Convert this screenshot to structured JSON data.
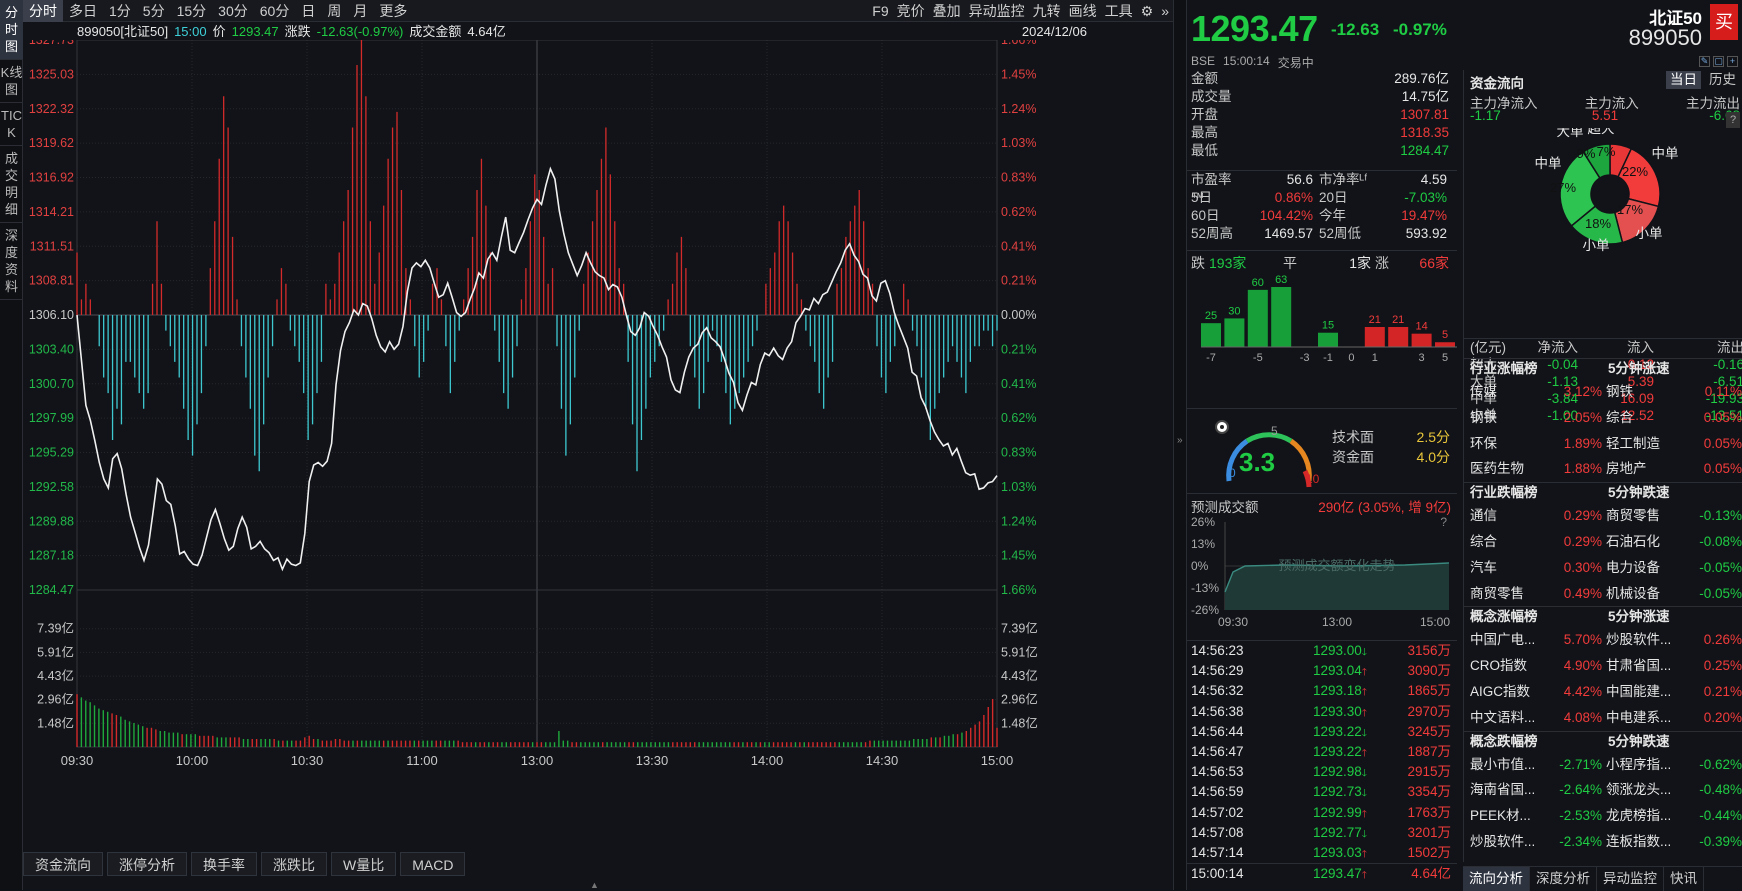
{
  "left_tabs": [
    {
      "label": "分时图",
      "active": true
    },
    {
      "label": "K线图"
    },
    {
      "label": "TICK"
    },
    {
      "label": "成交明细"
    },
    {
      "label": "深度资料"
    }
  ],
  "top_tabs": [
    {
      "label": "分时",
      "active": true
    },
    {
      "label": "多日"
    },
    {
      "label": "1分"
    },
    {
      "label": "5分"
    },
    {
      "label": "15分"
    },
    {
      "label": "30分"
    },
    {
      "label": "60分"
    },
    {
      "label": "日"
    },
    {
      "label": "周"
    },
    {
      "label": "月"
    },
    {
      "label": "更多"
    }
  ],
  "right_tools": [
    "F9",
    "竞价",
    "叠加",
    "异动监控",
    "九转",
    "画线",
    "工具"
  ],
  "info": {
    "code": "899050[北证50]",
    "time": "15:00",
    "price_label": "价",
    "price": "1293.47",
    "chg_label": "涨跌",
    "chg": "-12.63(-0.97%)",
    "amount_label": "成交金额",
    "amount": "4.64亿",
    "date": "2024/12/06"
  },
  "chart_data": {
    "type": "line",
    "x_ticks": [
      "09:30",
      "10:00",
      "10:30",
      "11:00",
      "13:00",
      "13:30",
      "14:00",
      "14:30",
      "15:00"
    ],
    "y_left_ticks": [
      "1327.73",
      "1325.03",
      "1322.32",
      "1319.62",
      "1316.92",
      "1314.21",
      "1311.51",
      "1308.81",
      "1306.10",
      "1303.40",
      "1300.70",
      "1297.99",
      "1295.29",
      "1292.58",
      "1289.88",
      "1287.18",
      "1284.47"
    ],
    "y_right_ticks": [
      "1.66%",
      "1.45%",
      "1.24%",
      "1.03%",
      "0.83%",
      "0.62%",
      "0.41%",
      "0.21%",
      "0.00%",
      "0.21%",
      "0.41%",
      "0.62%",
      "0.83%",
      "1.03%",
      "1.24%",
      "1.45%",
      "1.66%"
    ],
    "ylim": [
      1284.47,
      1327.73
    ],
    "prev_close": 1306.1,
    "price": [
      1306.1,
      1302.5,
      1299.0,
      1297.8,
      1296.2,
      1294.5,
      1293.2,
      1292.5,
      1294.8,
      1295.2,
      1294.0,
      1292.0,
      1290.2,
      1289.0,
      1287.8,
      1286.8,
      1288.0,
      1290.5,
      1293.2,
      1292.8,
      1291.5,
      1291.2,
      1289.5,
      1287.3,
      1287.5,
      1286.9,
      1286.5,
      1286.4,
      1287.2,
      1288.6,
      1290.0,
      1290.8,
      1289.7,
      1288.5,
      1287.6,
      1287.9,
      1289.3,
      1290.2,
      1289.4,
      1287.7,
      1287.9,
      1288.3,
      1287.7,
      1287.4,
      1286.8,
      1287.0,
      1286.1,
      1286.9,
      1286.5,
      1286.4,
      1286.6,
      1288.9,
      1293.0,
      1294.3,
      1294.5,
      1294.2,
      1294.6,
      1296.0,
      1300.6,
      1303.3,
      1304.8,
      1305.5,
      1306.5,
      1306.1,
      1307.0,
      1306.8,
      1305.8,
      1304.5,
      1303.6,
      1303.2,
      1304.0,
      1303.4,
      1303.8,
      1305.2,
      1308.0,
      1309.8,
      1310.2,
      1309.9,
      1310.4,
      1309.8,
      1308.6,
      1307.5,
      1307.7,
      1308.6,
      1307.5,
      1306.3,
      1306.0,
      1306.3,
      1307.3,
      1308.2,
      1309.4,
      1309.0,
      1310.5,
      1311.0,
      1310.4,
      1312.2,
      1313.8,
      1311.2,
      1311.0,
      1311.8,
      1312.6,
      1313.6,
      1314.5,
      1315.2,
      1314.8,
      1316.3,
      1317.6,
      1316.8,
      1314.3,
      1312.5,
      1311.0,
      1310.1,
      1309.2,
      1310.0,
      1311.0,
      1310.2,
      1309.5,
      1309.2,
      1309.0,
      1308.1,
      1308.5,
      1308.3,
      1307.5,
      1306.1,
      1304.8,
      1304.5,
      1305.1,
      1306.3,
      1306.0,
      1305.2,
      1304.5,
      1303.6,
      1302.8,
      1301.0,
      1300.2,
      1300.0,
      1301.6,
      1302.8,
      1303.5,
      1303.8,
      1304.7,
      1305.1,
      1304.3,
      1304.0,
      1303.6,
      1302.6,
      1301.5,
      1300.8,
      1299.2,
      1298.6,
      1299.8,
      1300.8,
      1300.6,
      1302.2,
      1303.1,
      1302.9,
      1303.5,
      1302.9,
      1302.6,
      1303.5,
      1304.0,
      1305.5,
      1306.0,
      1306.6,
      1306.5,
      1307.4,
      1307.0,
      1307.7,
      1307.9,
      1308.7,
      1309.5,
      1310.2,
      1311.2,
      1311.7,
      1310.8,
      1310.3,
      1309.3,
      1309.0,
      1307.6,
      1307.2,
      1308.6,
      1308.8,
      1307.8,
      1306.3,
      1305.3,
      1304.4,
      1303.5,
      1301.6,
      1301.3,
      1299.6,
      1298.9,
      1297.8,
      1296.9,
      1296.3,
      1295.8,
      1296.0,
      1295.1,
      1295.6,
      1294.6,
      1293.7,
      1293.5,
      1293.6,
      1292.4,
      1292.5,
      1292.9,
      1293.0,
      1293.47
    ],
    "minute_bars": [
      4,
      1,
      2,
      1,
      0,
      -2,
      -4,
      -5,
      -8,
      -6,
      -7,
      -3,
      -3,
      -4,
      -5,
      -6,
      -5,
      2,
      6,
      2,
      -1,
      -2,
      -3,
      -4,
      -6,
      -8,
      -9,
      -7,
      -5,
      -2,
      3,
      6,
      10,
      14,
      12,
      5,
      1,
      -2,
      -4,
      -6,
      -9,
      -10,
      -7,
      -4,
      -2,
      1,
      3,
      2,
      -1,
      -2,
      -3,
      -5,
      -8,
      -7,
      -5,
      -3,
      2,
      1,
      2,
      4,
      6,
      8,
      12,
      16,
      18,
      14,
      6,
      2,
      4,
      7,
      10,
      12,
      13,
      8,
      3,
      1,
      -2,
      -4,
      -3,
      -1,
      2,
      3,
      1,
      -2,
      -5,
      -3,
      -1,
      1,
      3,
      5,
      8,
      10,
      7,
      4,
      -1,
      -3,
      -5,
      -6,
      -4,
      -2,
      1,
      3,
      6,
      9,
      8,
      5,
      2,
      3,
      -2,
      -6,
      -9,
      -7,
      -4,
      -1,
      2,
      4,
      6,
      8,
      10,
      12,
      9,
      6,
      3,
      2,
      -3,
      -7,
      -10,
      -8,
      -6,
      -4,
      -3,
      -2,
      -1,
      1,
      2,
      4,
      5,
      3,
      -2,
      -4,
      -6,
      -5,
      -3,
      -1,
      -2,
      -3,
      -5,
      -7,
      -6,
      -5,
      -4,
      -3,
      -2,
      -1,
      0,
      2,
      3,
      4,
      6,
      7,
      6,
      4,
      2,
      1,
      -1,
      -2,
      -3,
      -5,
      -6,
      -4,
      -3,
      2,
      3,
      5,
      6,
      7,
      8,
      6,
      3,
      2,
      -2,
      -4,
      -5,
      -3,
      -2,
      0,
      2,
      1,
      -1,
      -2,
      -4,
      -6,
      -8,
      -6,
      -5,
      -4,
      -3,
      -2,
      -3,
      -4,
      -5,
      -3,
      -2,
      -2,
      -1,
      -1,
      -2,
      -1
    ]
  },
  "volume": {
    "y_ticks": [
      "7.39亿",
      "5.91亿",
      "4.43亿",
      "2.96亿",
      "1.48亿"
    ],
    "ylim": [
      0,
      8.87
    ],
    "values": [
      3.3,
      3.1,
      2.9,
      2.8,
      2.6,
      2.4,
      2.3,
      2.2,
      2.1,
      2.0,
      1.9,
      1.7,
      1.6,
      1.5,
      1.4,
      1.3,
      1.2,
      1.2,
      1.1,
      1.0,
      1.0,
      0.9,
      0.9,
      0.9,
      0.8,
      0.8,
      0.8,
      0.8,
      0.7,
      0.7,
      0.7,
      0.7,
      0.6,
      0.6,
      0.6,
      0.6,
      0.6,
      0.6,
      0.5,
      0.5,
      0.5,
      0.5,
      0.5,
      0.5,
      0.5,
      0.5,
      0.4,
      0.4,
      0.4,
      0.4,
      0.4,
      0.4,
      0.6,
      0.7,
      0.5,
      0.5,
      0.4,
      0.4,
      0.4,
      0.5,
      0.5,
      0.4,
      0.4,
      0.4,
      0.4,
      0.4,
      0.4,
      0.4,
      0.4,
      0.4,
      0.4,
      0.4,
      0.4,
      0.4,
      0.4,
      0.4,
      0.4,
      0.4,
      0.4,
      0.4,
      0.4,
      0.4,
      0.4,
      0.4,
      0.4,
      0.4,
      0.4,
      0.4,
      0.3,
      0.3,
      0.3,
      0.3,
      0.3,
      0.3,
      0.3,
      0.3,
      0.3,
      0.3,
      0.3,
      0.3,
      0.3,
      0.3,
      0.3,
      0.3,
      0.3,
      0.3,
      0.3,
      0.3,
      0.3,
      0.3,
      1.0,
      0.4,
      0.4,
      0.3,
      0.3,
      0.3,
      0.3,
      0.3,
      0.3,
      0.3,
      0.3,
      0.3,
      0.3,
      0.3,
      0.3,
      0.3,
      0.3,
      0.3,
      0.3,
      0.3,
      0.3,
      0.3,
      0.3,
      0.3,
      0.3,
      0.3,
      0.3,
      0.3,
      0.3,
      0.3,
      0.3,
      0.3,
      0.3,
      0.3,
      0.3,
      0.3,
      0.3,
      0.3,
      0.3,
      0.3,
      0.3,
      0.3,
      0.3,
      0.3,
      0.3,
      0.3,
      0.3,
      0.3,
      0.3,
      0.3,
      0.3,
      0.3,
      0.3,
      0.3,
      0.3,
      0.3,
      0.3,
      0.3,
      0.3,
      0.3,
      0.3,
      0.3,
      0.3,
      0.3,
      0.3,
      0.3,
      0.3,
      0.3,
      0.3,
      0.3,
      0.3,
      0.4,
      0.4,
      0.4,
      0.4,
      0.4,
      0.4,
      0.4,
      0.4,
      0.4,
      0.4,
      0.5,
      0.5,
      0.5,
      0.5,
      0.6,
      0.6,
      0.6,
      0.7,
      0.7,
      0.8,
      0.8,
      0.9,
      1.0,
      1.2,
      1.4,
      1.6,
      2.0,
      2.5,
      3.0,
      1.2
    ]
  },
  "bottom_tabs": [
    "资金流向",
    "涨停分析",
    "换手率",
    "涨跌比",
    "W量比",
    "MACD"
  ],
  "header": {
    "price": "1293.47",
    "chg": "-12.63",
    "pct": "-0.97%",
    "name": "北证50",
    "code": "899050",
    "buy": "买",
    "exchange": "BSE",
    "time": "15:00:14",
    "status": "交易中"
  },
  "quotes": [
    {
      "k": "金额",
      "v": "289.76亿",
      "c": "white"
    },
    {
      "k": "成交量",
      "v": "14.75亿",
      "c": "white"
    },
    {
      "k": "开盘",
      "v": "1307.81",
      "c": "red"
    },
    {
      "k": "最高",
      "v": "1318.35",
      "c": "red"
    },
    {
      "k": "最低",
      "v": "1284.47",
      "c": "green"
    }
  ],
  "ratios": [
    {
      "k1": "市盈率™",
      "v1": "56.6",
      "c1": "white",
      "k2": "市净率ᴸᶠ",
      "v2": "4.59",
      "c2": "white"
    },
    {
      "k1": "5日",
      "v1": "0.86%",
      "c1": "red",
      "k2": "20日",
      "v2": "-7.03%",
      "c2": "green"
    },
    {
      "k1": "60日",
      "v1": "104.42%",
      "c1": "red",
      "k2": "今年",
      "v2": "19.47%",
      "c2": "red"
    },
    {
      "k1": "52周高",
      "v1": "1469.57",
      "c1": "white",
      "k2": "52周低",
      "v2": "593.92",
      "c2": "white"
    }
  ],
  "dist": {
    "down_label": "跌",
    "down": "193家",
    "flat_label": "平",
    "flat": "1家",
    "up_label": "涨",
    "up": "66家",
    "bars": [
      {
        "x": "-7",
        "v": 25,
        "c": "#17a03a"
      },
      {
        "x": "",
        "v": 30,
        "c": "#17a03a"
      },
      {
        "x": "-5",
        "v": 60,
        "c": "#17a03a"
      },
      {
        "x": "",
        "v": 63,
        "c": "#17a03a"
      },
      {
        "x": "-3",
        "v": 0,
        "c": "#17a03a"
      },
      {
        "x": "-1",
        "v": 15,
        "c": "#17a03a"
      },
      {
        "x": "0",
        "v": 0,
        "c": "#888"
      },
      {
        "x": "1",
        "v": 21,
        "c": "#d32525"
      },
      {
        "x": "",
        "v": 21,
        "c": "#d32525"
      },
      {
        "x": "3",
        "v": 14,
        "c": "#d32525"
      },
      {
        "x": "5",
        "v": 5,
        "c": "#d32525"
      },
      {
        "x": "7",
        "v": 5,
        "c": "#d32525"
      }
    ],
    "labels": [
      "25",
      "30",
      "60",
      "63",
      "15",
      "21",
      "21",
      "14",
      "5",
      "5"
    ],
    "axis": [
      "-7",
      "-5",
      "-3",
      "-1",
      "0",
      "1",
      "3",
      "5",
      "7"
    ]
  },
  "gauge": {
    "value": "3.3",
    "max_label": "10",
    "min_label": "0",
    "mid_label": "5",
    "tech_label": "技术面",
    "tech": "2.5分",
    "fund_label": "资金面",
    "fund": "4.0分"
  },
  "forecast": {
    "label": "预测成交额",
    "value": "290亿 (3.05%, 增 9亿)",
    "help": "?",
    "watermark": "预测成交额变化走势",
    "y_ticks": [
      "26%",
      "13%",
      "0%",
      "-13%",
      "-26%"
    ],
    "x_ticks": [
      "09:30",
      "13:00",
      "15:00"
    ]
  },
  "ticks": [
    {
      "t": "14:56:23",
      "p": "1293.00",
      "d": "down",
      "v": "3156万",
      "vc": "red"
    },
    {
      "t": "14:56:29",
      "p": "1293.04",
      "d": "up",
      "v": "3090万",
      "vc": "red"
    },
    {
      "t": "14:56:32",
      "p": "1293.18",
      "d": "up",
      "v": "1865万",
      "vc": "red"
    },
    {
      "t": "14:56:38",
      "p": "1293.30",
      "d": "up",
      "v": "2970万",
      "vc": "red"
    },
    {
      "t": "14:56:44",
      "p": "1293.22",
      "d": "down",
      "v": "3245万",
      "vc": "red"
    },
    {
      "t": "14:56:47",
      "p": "1293.22",
      "d": "up",
      "v": "1887万",
      "vc": "red"
    },
    {
      "t": "14:56:53",
      "p": "1292.98",
      "d": "down",
      "v": "2915万",
      "vc": "red"
    },
    {
      "t": "14:56:59",
      "p": "1292.73",
      "d": "down",
      "v": "3354万",
      "vc": "red"
    },
    {
      "t": "14:57:02",
      "p": "1292.99",
      "d": "up",
      "v": "1763万",
      "vc": "red"
    },
    {
      "t": "14:57:08",
      "p": "1292.77",
      "d": "down",
      "v": "3201万",
      "vc": "red"
    },
    {
      "t": "14:57:14",
      "p": "1293.03",
      "d": "up",
      "v": "1502万",
      "vc": "red"
    },
    {
      "t": "15:00:14",
      "p": "1293.47",
      "d": "up",
      "v": "4.64亿",
      "vc": "red"
    }
  ],
  "flow": {
    "title": "资金流向",
    "btn_today": "当日",
    "btn_hist": "历史",
    "cols": [
      "主力净流入",
      "主力流入",
      "主力流出"
    ],
    "vals": [
      {
        "v": "-1.17",
        "c": "green"
      },
      {
        "v": "5.51",
        "c": "red"
      },
      {
        "v": "-6.68",
        "c": "green"
      }
    ],
    "donut": [
      {
        "name": "超大",
        "pct": 7,
        "c": "#e93636"
      },
      {
        "name": "中单",
        "pct": 22,
        "c": "#f03c3c"
      },
      {
        "name": "小单",
        "pct": 17,
        "c": "#e34b4b"
      },
      {
        "name": "",
        "pct": 18,
        "c": "#27b84a"
      },
      {
        "name": "",
        "pct": 27,
        "c": "#2bc24f"
      },
      {
        "name": "",
        "pct": 9,
        "c": "#1da53e"
      }
    ],
    "donut_labels": [
      "9%",
      "7%",
      "22%",
      "17%",
      "18%",
      "27%"
    ],
    "donut_names": [
      "大单",
      "超大",
      "中单",
      "小单",
      "小单",
      "中单"
    ],
    "help": "?",
    "table_hdr": [
      "(亿元)",
      "净流入",
      "流入",
      "流出"
    ],
    "table": [
      {
        "k": "超大",
        "a": "-0.04",
        "ac": "green",
        "b": "0.12",
        "bc": "red",
        "c": "-0.16",
        "cc": "green"
      },
      {
        "k": "大单",
        "a": "-1.13",
        "ac": "green",
        "b": "5.39",
        "bc": "red",
        "c": "-6.51",
        "cc": "green"
      },
      {
        "k": "中单",
        "a": "-3.84",
        "ac": "green",
        "b": "16.09",
        "bc": "red",
        "c": "-19.93",
        "cc": "green"
      },
      {
        "k": "小单",
        "a": "-1.00",
        "ac": "green",
        "b": "12.52",
        "bc": "red",
        "c": "-13.51",
        "cc": "green"
      }
    ]
  },
  "boards": [
    {
      "h1": "行业涨幅榜",
      "h2": "5分钟涨速",
      "rows": [
        {
          "a": "传媒",
          "av": "3.12%",
          "ac": "red",
          "b": "钢铁",
          "bv": "0.11%",
          "bc": "red"
        },
        {
          "a": "钢铁",
          "av": "2.05%",
          "ac": "red",
          "b": "综合",
          "bv": "0.05%",
          "bc": "red"
        },
        {
          "a": "环保",
          "av": "1.89%",
          "ac": "red",
          "b": "轻工制造",
          "bv": "0.05%",
          "bc": "red"
        },
        {
          "a": "医药生物",
          "av": "1.88%",
          "ac": "red",
          "b": "房地产",
          "bv": "0.05%",
          "bc": "red"
        }
      ]
    },
    {
      "h1": "行业跌幅榜",
      "h2": "5分钟跌速",
      "rows": [
        {
          "a": "通信",
          "av": "0.29%",
          "ac": "red",
          "b": "商贸零售",
          "bv": "-0.13%",
          "bc": "green"
        },
        {
          "a": "综合",
          "av": "0.29%",
          "ac": "red",
          "b": "石油石化",
          "bv": "-0.08%",
          "bc": "green"
        },
        {
          "a": "汽车",
          "av": "0.30%",
          "ac": "red",
          "b": "电力设备",
          "bv": "-0.05%",
          "bc": "green"
        },
        {
          "a": "商贸零售",
          "av": "0.49%",
          "ac": "red",
          "b": "机械设备",
          "bv": "-0.05%",
          "bc": "green"
        }
      ]
    },
    {
      "h1": "概念涨幅榜",
      "h2": "5分钟涨速",
      "rows": [
        {
          "a": "中国广电...",
          "av": "5.70%",
          "ac": "red",
          "b": "炒股软件...",
          "bv": "0.26%",
          "bc": "red"
        },
        {
          "a": "CRO指数",
          "av": "4.90%",
          "ac": "red",
          "b": "甘肃省国...",
          "bv": "0.25%",
          "bc": "red"
        },
        {
          "a": "AIGC指数",
          "av": "4.42%",
          "ac": "red",
          "b": "中国能建...",
          "bv": "0.21%",
          "bc": "red"
        },
        {
          "a": "中文语料...",
          "av": "4.08%",
          "ac": "red",
          "b": "中电建系...",
          "bv": "0.20%",
          "bc": "red"
        }
      ]
    },
    {
      "h1": "概念跌幅榜",
      "h2": "5分钟跌速",
      "rows": [
        {
          "a": "最小市值...",
          "av": "-2.71%",
          "ac": "green",
          "b": "小程序指...",
          "bv": "-0.62%",
          "bc": "green"
        },
        {
          "a": "海南省国...",
          "av": "-2.64%",
          "ac": "green",
          "b": "领涨龙头...",
          "bv": "-0.48%",
          "bc": "green"
        },
        {
          "a": "PEEK材...",
          "av": "-2.53%",
          "ac": "green",
          "b": "龙虎榜指...",
          "bv": "-0.44%",
          "bc": "green"
        },
        {
          "a": "炒股软件...",
          "av": "-2.34%",
          "ac": "green",
          "b": "连板指数...",
          "bv": "-0.39%",
          "bc": "green"
        }
      ]
    }
  ],
  "right_tabs": [
    {
      "label": "流向分析",
      "active": true
    },
    {
      "label": "深度分析"
    },
    {
      "label": "异动监控"
    },
    {
      "label": "快讯"
    }
  ]
}
